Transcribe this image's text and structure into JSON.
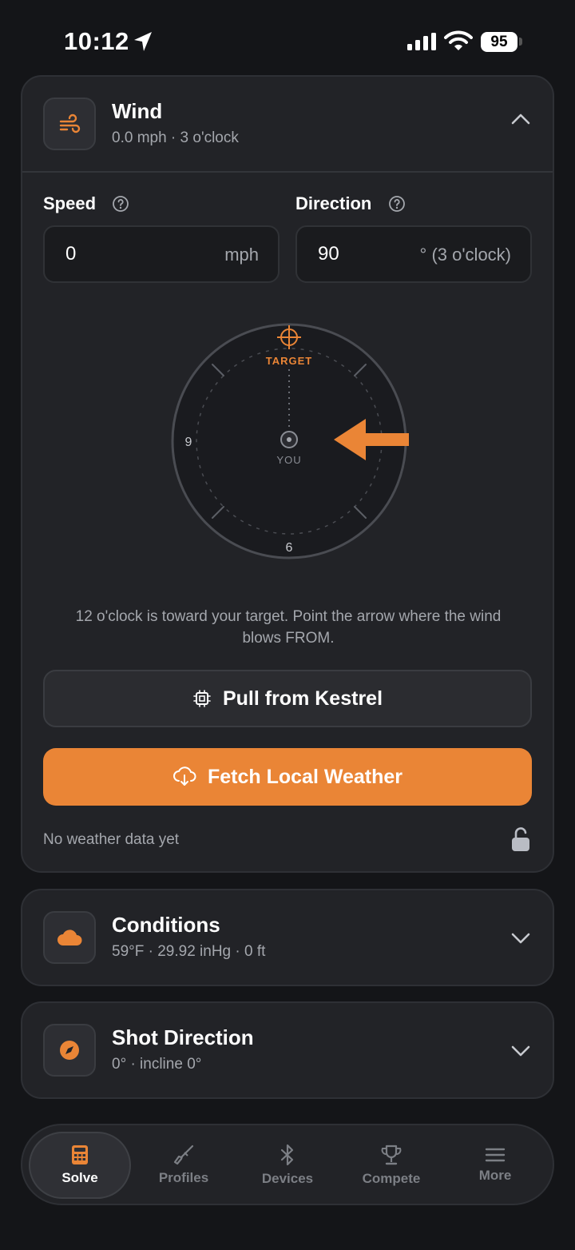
{
  "status": {
    "time": "10:12",
    "battery": "95"
  },
  "wind": {
    "title": "Wind",
    "subtitle": "0.0 mph · 3 o'clock",
    "speed_label": "Speed",
    "speed_value": "0",
    "speed_unit": "mph",
    "direction_label": "Direction",
    "direction_value": "90",
    "direction_unit": "° (3 o'clock)",
    "dial": {
      "target_label": "TARGET",
      "you_label": "YOU",
      "label_9": "9",
      "label_6": "6",
      "wind_clock": 3
    },
    "hint": "12 o'clock is toward your target. Point the arrow where the wind blows FROM.",
    "kestrel_button": "Pull from Kestrel",
    "weather_button": "Fetch Local Weather",
    "weather_status": "No weather data yet"
  },
  "conditions": {
    "title": "Conditions",
    "subtitle": "59°F · 29.92 inHg · 0 ft"
  },
  "shot_direction": {
    "title": "Shot Direction",
    "subtitle": "0° · incline 0°"
  },
  "tabs": [
    {
      "label": "Solve",
      "icon": "calculator-icon",
      "active": true
    },
    {
      "label": "Profiles",
      "icon": "rifle-icon",
      "active": false
    },
    {
      "label": "Devices",
      "icon": "bluetooth-icon",
      "active": false
    },
    {
      "label": "Compete",
      "icon": "trophy-icon",
      "active": false
    },
    {
      "label": "More",
      "icon": "menu-icon",
      "active": false
    }
  ],
  "colors": {
    "accent": "#ea8536",
    "background": "#141518",
    "card": "#222327",
    "muted": "#a4a7ad"
  }
}
